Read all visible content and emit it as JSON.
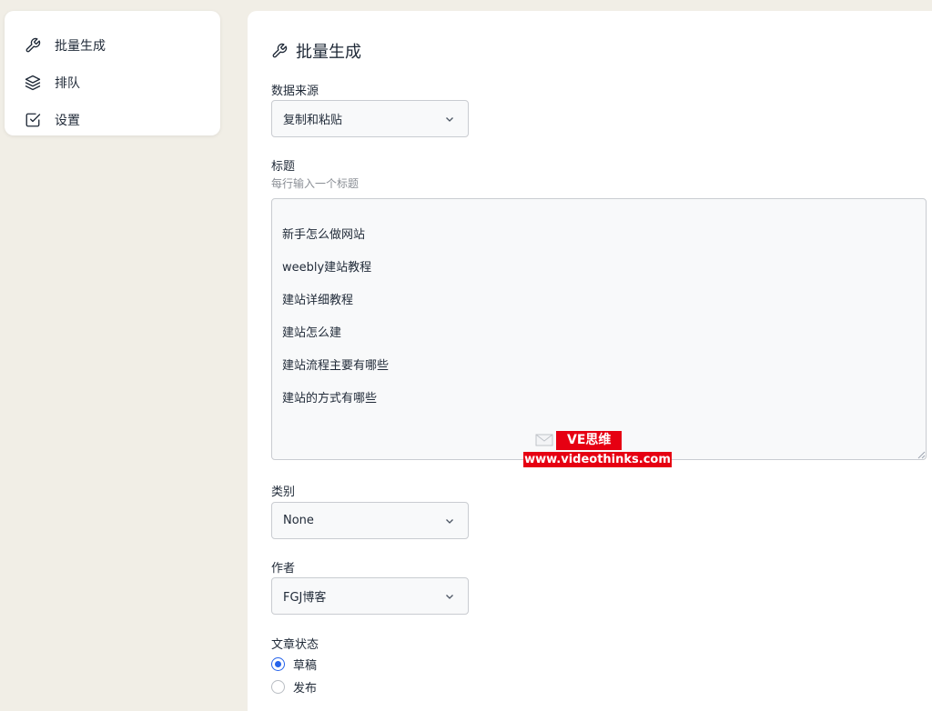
{
  "sidebar": {
    "items": [
      {
        "label": "批量生成",
        "icon": "wrench-icon"
      },
      {
        "label": "排队",
        "icon": "layers-icon"
      },
      {
        "label": "设置",
        "icon": "checkbox-icon"
      }
    ]
  },
  "main": {
    "title": "批量生成",
    "title_icon": "wrench-icon",
    "data_source": {
      "label": "数据来源",
      "value": "复制和粘贴"
    },
    "titles": {
      "label": "标题",
      "hint": "每行输入一个标题",
      "lines": [
        "新手怎么做网站",
        "weebly建站教程",
        "建站详细教程",
        "建站怎么建",
        "建站流程主要有哪些",
        "建站的方式有哪些"
      ]
    },
    "category": {
      "label": "类别",
      "value": "None"
    },
    "author": {
      "label": "作者",
      "value": "FGJ博客"
    },
    "post_status": {
      "label": "文章状态",
      "options": [
        {
          "label": "草稿",
          "checked": true
        },
        {
          "label": "发布",
          "checked": false
        }
      ]
    }
  },
  "watermark": {
    "brand": "VE思维",
    "url": "www.videothinks.com"
  },
  "colors": {
    "background": "#f1eee6",
    "accent": "#2563eb",
    "watermark_red": "#e60012"
  }
}
